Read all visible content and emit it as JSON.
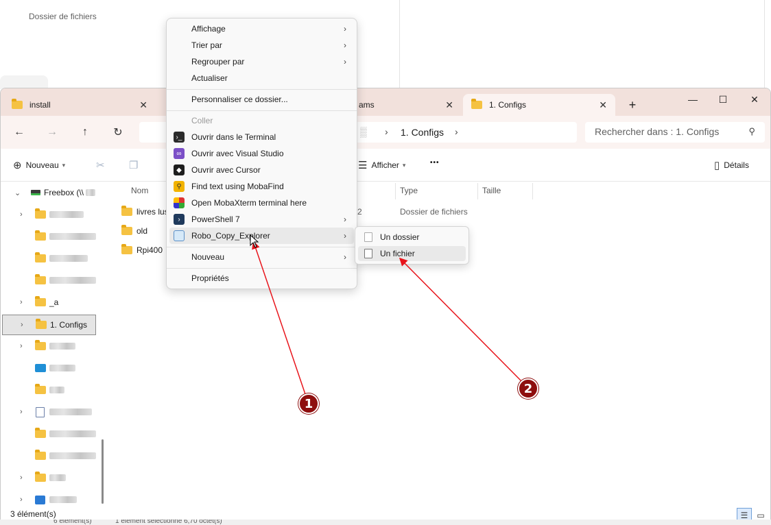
{
  "background_window": {
    "label": "Dossier de fichiers"
  },
  "tabs": [
    {
      "label": "install"
    },
    {
      "label": "ams"
    },
    {
      "label": "1. Configs"
    }
  ],
  "window_controls": {
    "minimize": "—",
    "maximize": "☐",
    "close": "✕",
    "new_tab": "+"
  },
  "address": {
    "crumb": "1. Configs"
  },
  "search": {
    "placeholder": "Rechercher dans : 1. Configs"
  },
  "commands": {
    "new": "Nouveau",
    "view": "Afficher",
    "more": "•••",
    "details": "Détails"
  },
  "tree": {
    "root": "Freebox (\\\\",
    "items": [
      {
        "label": "_a"
      },
      {
        "label": "1. Configs"
      }
    ]
  },
  "columns": {
    "name": "Nom",
    "type": "Type",
    "size": "Taille"
  },
  "files": [
    {
      "name": "livres lus",
      "type": "Dossier de fichiers",
      "date_fragment": "2"
    },
    {
      "name": "old",
      "type": "",
      "date_fragment": ""
    },
    {
      "name": "Rpi400",
      "type": "",
      "date_fragment": ""
    }
  ],
  "status": {
    "count": "3 élément(s)"
  },
  "bottom_strip": {
    "left": "6 élément(s)",
    "right": "1 élément sélectionné  6,70 octet(s)"
  },
  "context_menu": {
    "affichage": "Affichage",
    "trier": "Trier par",
    "regrouper": "Regrouper par",
    "actualiser": "Actualiser",
    "personnaliser": "Personnaliser ce dossier...",
    "coller": "Coller",
    "terminal": "Ouvrir dans le Terminal",
    "visual_studio": "Ouvrir avec Visual Studio",
    "cursor": "Ouvrir avec Cursor",
    "mobafind": "Find text using MobaFind",
    "mobaxterm": "Open MobaXterm terminal here",
    "powershell": "PowerShell 7",
    "robocopy": "Robo_Copy_Explorer",
    "nouveau": "Nouveau",
    "proprietes": "Propriétés"
  },
  "submenu": {
    "dossier": "Un dossier",
    "fichier": "Un fichier"
  },
  "annotations": {
    "one": "1",
    "two": "2"
  },
  "colors": {
    "tab_bar": "#f2e1dc",
    "nav_bar": "#fbf3f1",
    "annotation": "#8e0e0e",
    "arrow": "#e8141b",
    "folder": "#f5c242"
  }
}
